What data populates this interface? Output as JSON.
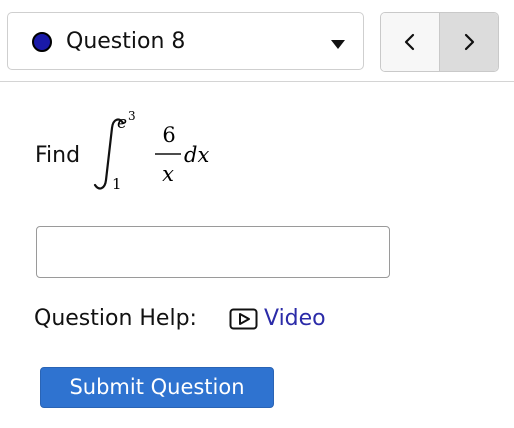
{
  "question_selector": {
    "label": "Question 8",
    "status_color": "#1a1aa8",
    "icons": {
      "status": "status-dot-icon",
      "dropdown": "caret-down-icon"
    }
  },
  "nav": {
    "prev_icon": "chevron-left-icon",
    "next_icon": "chevron-right-icon"
  },
  "problem": {
    "prompt": "Find",
    "integral": {
      "lower_limit": "1",
      "upper_base": "e",
      "upper_exponent": "3",
      "numerator": "6",
      "denominator": "x",
      "differential": "dx"
    }
  },
  "answer_input": {
    "value": "",
    "placeholder": ""
  },
  "help": {
    "label": "Question Help:",
    "video_label": "Video",
    "video_icon": "play-video-icon",
    "link_color": "#2b2ba8"
  },
  "submit": {
    "label": "Submit Question",
    "color": "#2f73d0"
  }
}
